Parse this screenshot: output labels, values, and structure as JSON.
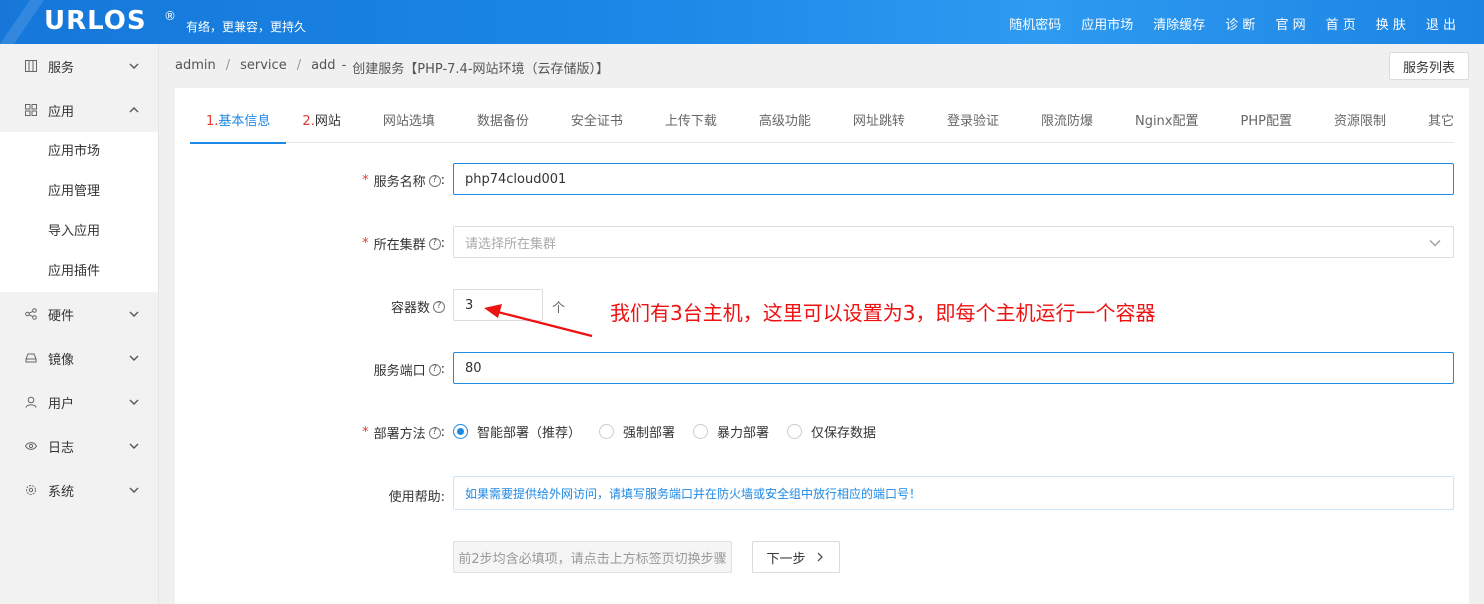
{
  "header": {
    "logo": "URLOS",
    "logo_mark": "®",
    "slogan": "有络，更兼容，更持久",
    "nav": [
      "随机密码",
      "应用市场",
      "清除缓存",
      "诊 断",
      "官 网",
      "首 页",
      "换 肤",
      "退 出"
    ]
  },
  "sidebar": {
    "items": [
      {
        "label": "服务",
        "icon": "grid-icon",
        "expanded": false
      },
      {
        "label": "应用",
        "icon": "apps-icon",
        "expanded": true
      },
      {
        "label": "硬件",
        "icon": "share-icon",
        "expanded": false
      },
      {
        "label": "镜像",
        "icon": "disk-icon",
        "expanded": false
      },
      {
        "label": "用户",
        "icon": "user-icon",
        "expanded": false
      },
      {
        "label": "日志",
        "icon": "eye-icon",
        "expanded": false
      },
      {
        "label": "系统",
        "icon": "gear-icon",
        "expanded": false
      }
    ],
    "submenu": [
      "应用市场",
      "应用管理",
      "导入应用",
      "应用插件"
    ]
  },
  "breadcrumb": {
    "items": [
      "admin",
      "service",
      "add"
    ],
    "title": "创建服务【PHP-7.4-网站环境（云存储版）】",
    "dash": "-"
  },
  "list_button": "服务列表",
  "tabs": [
    {
      "num": "1.",
      "label": "基本信息"
    },
    {
      "num": "2.",
      "label": "网站"
    },
    {
      "label": "网站选填"
    },
    {
      "label": "数据备份"
    },
    {
      "label": "安全证书"
    },
    {
      "label": "上传下载"
    },
    {
      "label": "高级功能"
    },
    {
      "label": "网址跳转"
    },
    {
      "label": "登录验证"
    },
    {
      "label": "限流防爆"
    },
    {
      "label": "Nginx配置"
    },
    {
      "label": "PHP配置"
    },
    {
      "label": "资源限制"
    },
    {
      "label": "其它"
    }
  ],
  "form": {
    "service_name": {
      "label": "服务名称",
      "value": "php74cloud001"
    },
    "cluster": {
      "label": "所在集群",
      "placeholder": "请选择所在集群"
    },
    "containers": {
      "label": "容器数",
      "value": "3",
      "unit": "个"
    },
    "port": {
      "label": "服务端口",
      "value": "80"
    },
    "deploy": {
      "label": "部署方法",
      "options": [
        "智能部署（推荐）",
        "强制部署",
        "暴力部署",
        "仅保存数据"
      ],
      "selected": 0
    },
    "help": {
      "label": "使用帮助:",
      "text": "如果需要提供给外网访问，请填写服务端口并在防火墙或安全组中放行相应的端口号！"
    },
    "colon": ":",
    "help_mark": "?",
    "required_mark": "*"
  },
  "buttons": {
    "hint": "前2步均含必填项，请点击上方标签页切换步骤",
    "next": "下一步"
  },
  "annotation": "我们有3台主机，这里可以设置为3，即每个主机运行一个容器",
  "colors": {
    "accent": "#1e88e5",
    "required": "#e53935",
    "annotation": "#ee1111"
  }
}
